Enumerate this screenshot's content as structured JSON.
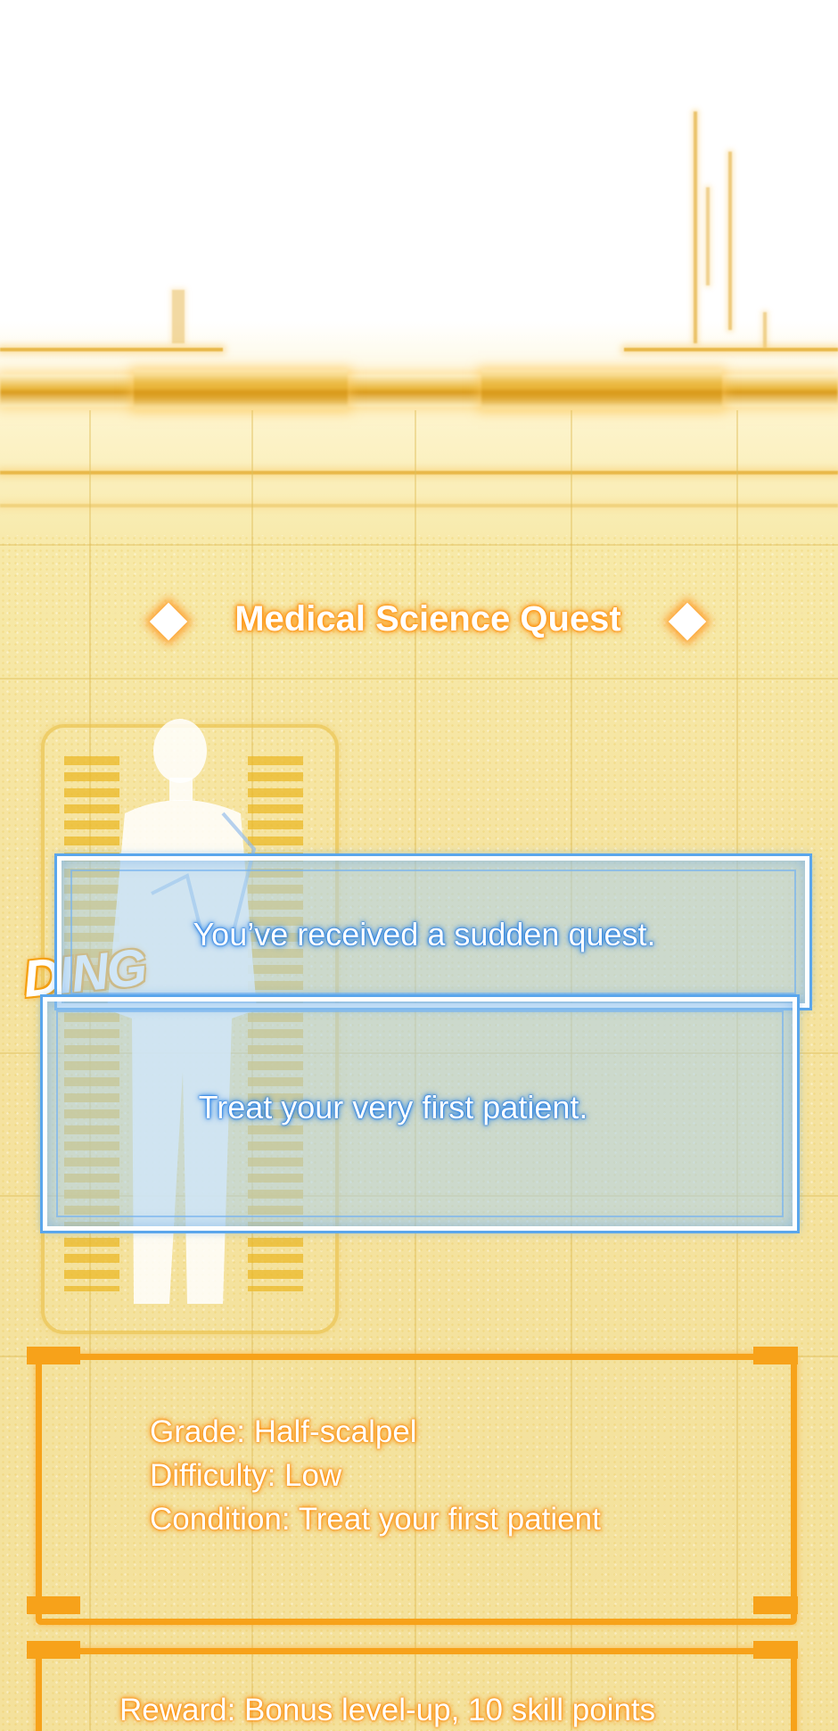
{
  "quest_title": "Medical Science Quest",
  "sfx": "DING",
  "notifications": [
    "You’ve received a sudden quest.",
    "Treat your very first patient."
  ],
  "details": {
    "grade": "Grade: Half-scalpel",
    "difficulty": "Difficulty: Low",
    "condition": "Condition: Treat your first patient"
  },
  "reward": "Reward: Bonus level-up, 10 skill points",
  "colors": {
    "gold": "#e9b53a",
    "orange": "#f7a21a",
    "blue": "#5aa6ec"
  },
  "icons": [
    "diamond-icon",
    "diamond-icon"
  ]
}
